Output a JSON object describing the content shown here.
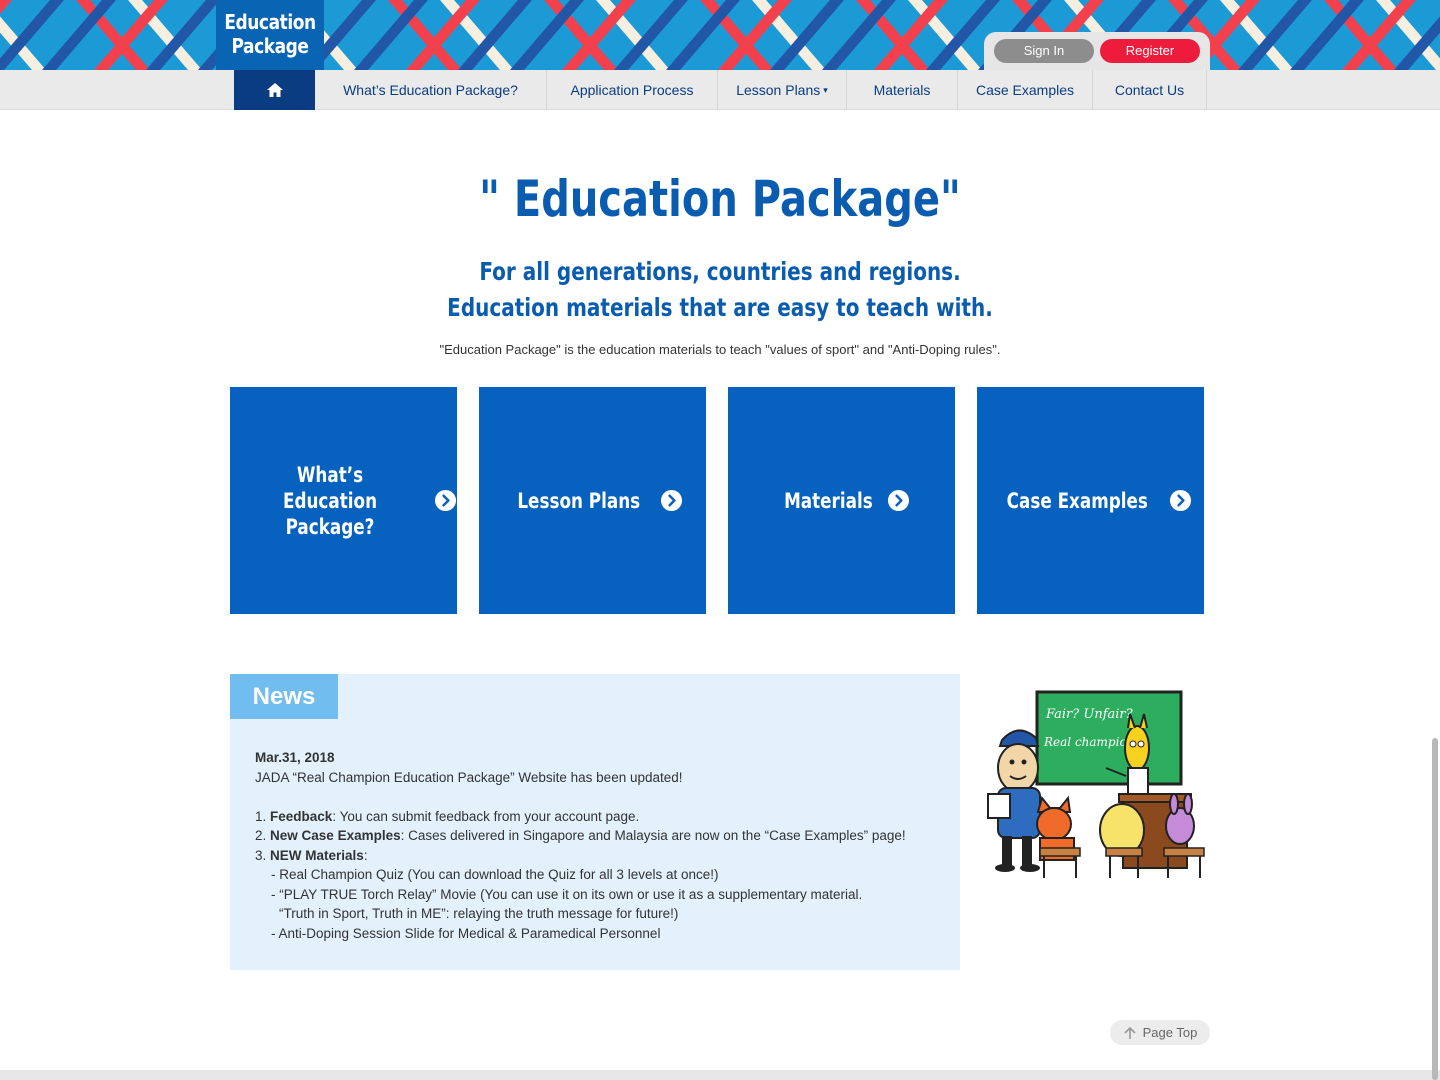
{
  "header": {
    "logo_line1": "Education",
    "logo_line2": "Package",
    "sign_in": "Sign In",
    "register": "Register"
  },
  "nav": {
    "home_icon": "home-icon",
    "items": [
      {
        "label": "What’s Education Package?"
      },
      {
        "label": "Application Process"
      },
      {
        "label": "Lesson Plans",
        "caret": "▾"
      },
      {
        "label": "Materials"
      },
      {
        "label": "Case Examples"
      },
      {
        "label": "Contact Us"
      }
    ]
  },
  "hero": {
    "title": "\" Education Package\"",
    "subtitle_line1": "For all generations, countries and regions.",
    "subtitle_line2": "Education materials that are easy to teach with.",
    "description": "\"Education Package\" is the education materials to teach \"values of sport\" and \"Anti-Doping rules\"."
  },
  "tiles": [
    {
      "line1": "What’s",
      "line2": "Education Package?"
    },
    {
      "line1": "Lesson Plans"
    },
    {
      "line1": "Materials"
    },
    {
      "line1": "Case Examples"
    }
  ],
  "news": {
    "heading": "News",
    "date": "Mar.31, 2018",
    "headline": "JADA “Real Champion Education Package” Website has been updated!",
    "item1_num": "1.",
    "item1_bold": "Feedback",
    "item1_text": ": You can submit feedback from your account page.",
    "item2_num": "2.",
    "item2_bold": "New Case Examples",
    "item2_text": ": Cases delivered in Singapore and Malaysia are now on the “Case Examples” page!",
    "item3_num": "3.",
    "item3_bold": "NEW Materials",
    "item3_text": ":",
    "sub1": "- Real Champion Quiz (You can download the Quiz for all 3 levels at once!)",
    "sub2": "- “PLAY TRUE Torch Relay” Movie (You can use it on its own or use it as a supplementary material.",
    "sub2b": "“Truth in Sport, Truth in ME”: relaying the truth message for future!)",
    "sub3": "- Anti-Doping Session Slide for Medical & Paramedical Personnel"
  },
  "illustration": {
    "board_line1": "Fair? Unfair?",
    "board_line2": "Real champion"
  },
  "page_top": "Page Top",
  "colors": {
    "brand_blue": "#0762bf",
    "nav_dark": "#0a3c82",
    "register_red": "#ee1c3c",
    "news_bg": "#e2f1fc",
    "news_tab": "#71bdf0"
  }
}
